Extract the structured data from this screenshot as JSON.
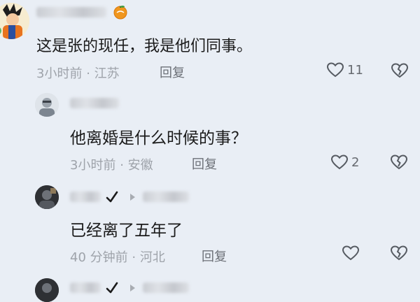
{
  "comments": [
    {
      "text": "这是张的现任，我是他们同事。",
      "time": "3小时前",
      "separator": "·",
      "location": "江苏",
      "reply_label": "回复",
      "likes": "11",
      "badge_icon": "orange-fruit-icon",
      "avatar_icon": "anime-character-avatar"
    },
    {
      "text": "他离婚是什么时候的事？",
      "time": "3小时前",
      "separator": "·",
      "location": "安徽",
      "reply_label": "回复",
      "likes": "2",
      "avatar_icon": "person-photo-avatar"
    },
    {
      "text": "已经离了五年了",
      "time": "40 分钟前",
      "separator": "·",
      "location": "河北",
      "reply_label": "回复",
      "likes": "",
      "avatar_icon": "person-photo-avatar"
    }
  ],
  "colors": {
    "background": "#e9eef5",
    "text": "#1b1b1b",
    "meta": "#9ea3aa",
    "icon": "#555a61"
  }
}
